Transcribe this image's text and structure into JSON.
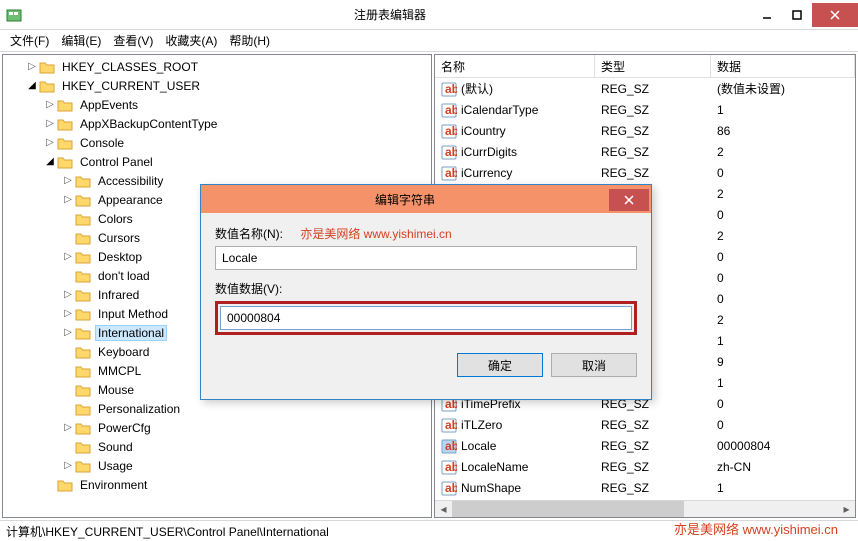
{
  "window": {
    "title": "注册表编辑器"
  },
  "menu": {
    "file": "文件(F)",
    "edit": "编辑(E)",
    "view": "查看(V)",
    "favorites": "收藏夹(A)",
    "help": "帮助(H)"
  },
  "tree": {
    "root_computer_hidden": "计算机",
    "items": [
      {
        "label": "HKEY_CLASSES_ROOT",
        "indent": 1,
        "exp": "closed"
      },
      {
        "label": "HKEY_CURRENT_USER",
        "indent": 1,
        "exp": "open"
      },
      {
        "label": "AppEvents",
        "indent": 2,
        "exp": "closed"
      },
      {
        "label": "AppXBackupContentType",
        "indent": 2,
        "exp": "closed"
      },
      {
        "label": "Console",
        "indent": 2,
        "exp": "closed"
      },
      {
        "label": "Control Panel",
        "indent": 2,
        "exp": "open"
      },
      {
        "label": "Accessibility",
        "indent": 3,
        "exp": "closed"
      },
      {
        "label": "Appearance",
        "indent": 3,
        "exp": "closed"
      },
      {
        "label": "Colors",
        "indent": 3,
        "exp": "none"
      },
      {
        "label": "Cursors",
        "indent": 3,
        "exp": "none"
      },
      {
        "label": "Desktop",
        "indent": 3,
        "exp": "closed"
      },
      {
        "label": "don't load",
        "indent": 3,
        "exp": "none"
      },
      {
        "label": "Infrared",
        "indent": 3,
        "exp": "closed"
      },
      {
        "label": "Input Method",
        "indent": 3,
        "exp": "closed"
      },
      {
        "label": "International",
        "indent": 3,
        "exp": "closed",
        "selected": true
      },
      {
        "label": "Keyboard",
        "indent": 3,
        "exp": "none"
      },
      {
        "label": "MMCPL",
        "indent": 3,
        "exp": "none"
      },
      {
        "label": "Mouse",
        "indent": 3,
        "exp": "none"
      },
      {
        "label": "Personalization",
        "indent": 3,
        "exp": "none"
      },
      {
        "label": "PowerCfg",
        "indent": 3,
        "exp": "closed"
      },
      {
        "label": "Sound",
        "indent": 3,
        "exp": "none"
      },
      {
        "label": "Usage",
        "indent": 3,
        "exp": "closed"
      },
      {
        "label": "Environment",
        "indent": 2,
        "exp": "none"
      }
    ]
  },
  "list": {
    "headers": {
      "name": "名称",
      "type": "类型",
      "data": "数据"
    },
    "rows": [
      {
        "name": "(默认)",
        "type": "REG_SZ",
        "data": "(数值未设置)"
      },
      {
        "name": "iCalendarType",
        "type": "REG_SZ",
        "data": "1"
      },
      {
        "name": "iCountry",
        "type": "REG_SZ",
        "data": "86"
      },
      {
        "name": "iCurrDigits",
        "type": "REG_SZ",
        "data": "2"
      },
      {
        "name": "iCurrency",
        "type": "REG_SZ",
        "data": "0"
      },
      {
        "name": "",
        "type": "",
        "data": "2"
      },
      {
        "name": "",
        "type": "",
        "data": "0"
      },
      {
        "name": "",
        "type": "",
        "data": "2"
      },
      {
        "name": "",
        "type": "",
        "data": "0"
      },
      {
        "name": "",
        "type": "",
        "data": "0"
      },
      {
        "name": "",
        "type": "",
        "data": "0"
      },
      {
        "name": "",
        "type": "",
        "data": "2"
      },
      {
        "name": "",
        "type": "",
        "data": "1"
      },
      {
        "name": "",
        "type": "",
        "data": "9"
      },
      {
        "name": "",
        "type": "",
        "data": "1"
      },
      {
        "name": "iTimePrefix",
        "type": "REG_SZ",
        "data": "0"
      },
      {
        "name": "iTLZero",
        "type": "REG_SZ",
        "data": "0"
      },
      {
        "name": "Locale",
        "type": "REG_SZ",
        "data": "00000804",
        "highlight": true
      },
      {
        "name": "LocaleName",
        "type": "REG_SZ",
        "data": "zh-CN"
      },
      {
        "name": "NumShape",
        "type": "REG_SZ",
        "data": "1"
      }
    ]
  },
  "statusbar": {
    "path": "计算机\\HKEY_CURRENT_USER\\Control Panel\\International"
  },
  "dialog": {
    "title": "编辑字符串",
    "name_label": "数值名称(N):",
    "name_value": "Locale",
    "data_label": "数值数据(V):",
    "data_value": "00000804",
    "ok": "确定",
    "cancel": "取消"
  },
  "watermark": {
    "text": "亦是美网络  www.yishimei.cn"
  }
}
